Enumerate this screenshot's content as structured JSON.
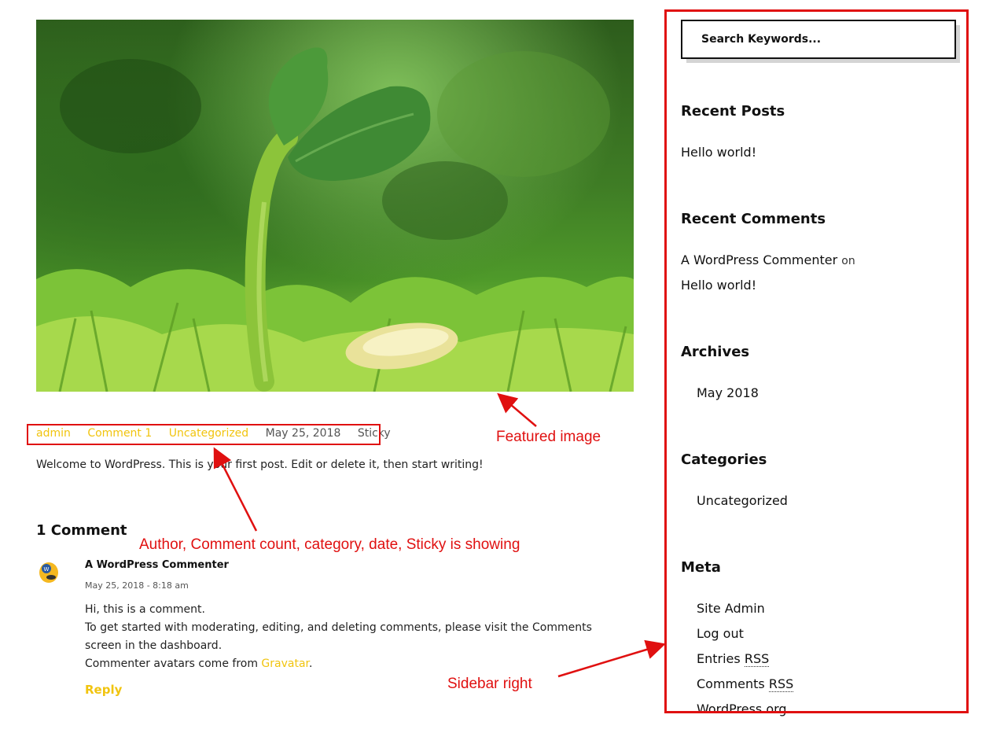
{
  "post": {
    "meta": {
      "author": "admin",
      "comments": "Comment 1",
      "category": "Uncategorized",
      "date": "May 25, 2018",
      "sticky": "Sticky"
    },
    "excerpt": "Welcome to WordPress. This is your first post. Edit or delete it, then start writing!"
  },
  "comments": {
    "title": "1 Comment",
    "items": [
      {
        "author": "A WordPress Commenter",
        "date": "May 25, 2018 - 8:18 am",
        "lines": [
          "Hi, this is a comment.",
          "To get started with moderating, editing, and deleting comments, please visit the Comments screen in the dashboard.",
          "Commenter avatars come from "
        ],
        "link_text": "Gravatar",
        "after_link": ".",
        "reply": "Reply"
      }
    ]
  },
  "sidebar": {
    "search_placeholder": "Search Keywords...",
    "recent_posts": {
      "title": "Recent Posts",
      "items": [
        "Hello world!"
      ]
    },
    "recent_comments": {
      "title": "Recent Comments",
      "author": "A WordPress Commenter",
      "on": "on",
      "post": "Hello world!"
    },
    "archives": {
      "title": "Archives",
      "items": [
        "May 2018"
      ]
    },
    "categories": {
      "title": "Categories",
      "items": [
        "Uncategorized"
      ]
    },
    "meta": {
      "title": "Meta",
      "site_admin": "Site Admin",
      "log_out": "Log out",
      "entries": "Entries",
      "comments": "Comments",
      "rss": "RSS",
      "wordpress_org": "WordPress.org"
    }
  },
  "annotations": {
    "featured": "Featured image",
    "meta": "Author, Comment count, category, date, Sticky is showing",
    "sidebar": "Sidebar right"
  },
  "colors": {
    "accent": "#f1c40f",
    "annotation": "#e01010"
  }
}
